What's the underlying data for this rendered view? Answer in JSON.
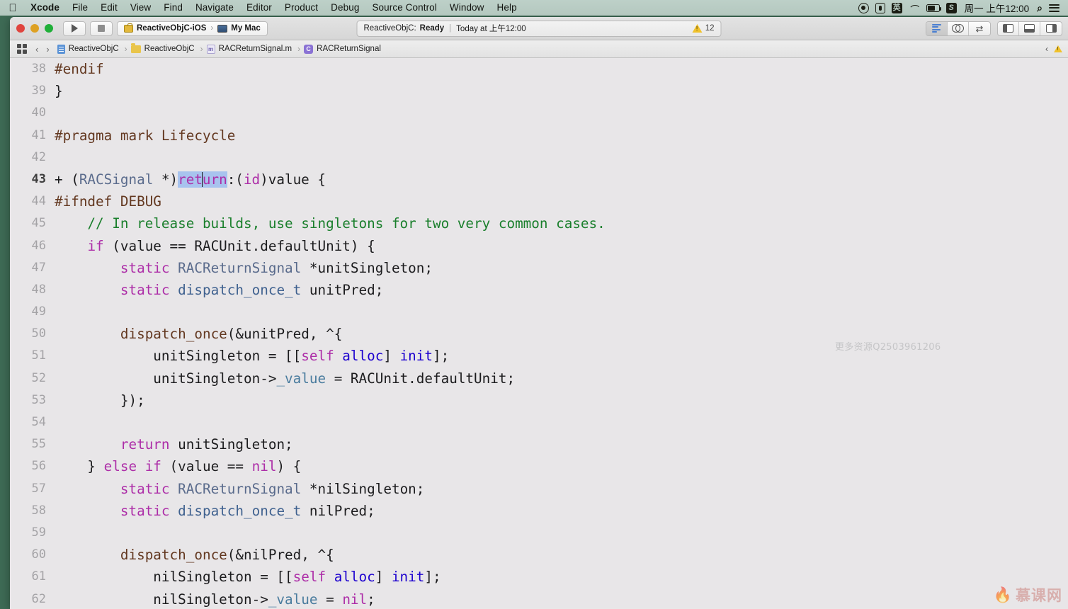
{
  "menubar": {
    "apple_icon": "apple-logo",
    "items": [
      "Xcode",
      "File",
      "Edit",
      "View",
      "Find",
      "Navigate",
      "Editor",
      "Product",
      "Debug",
      "Source Control",
      "Window",
      "Help"
    ],
    "status_icons": [
      "record-icon",
      "microphone-icon",
      "input-method-icon",
      "wifi-icon",
      "battery-charging-icon",
      "sogou-input-icon"
    ],
    "ime_label": "英",
    "sogou_label": "S",
    "clock": "周一 上午12:00",
    "search_icon": "search-icon",
    "control_center_icon": "control-center-icon",
    "bg_color": "#b4c8bf"
  },
  "toolbar": {
    "close_label": "",
    "run_icon": "play-icon",
    "stop_icon": "stop-icon",
    "scheme": {
      "target_icon": "toolbox-icon",
      "target": "ReactiveObjC-iOS",
      "separator": "›",
      "destination_icon": "mac-icon",
      "destination": "My Mac"
    },
    "status": {
      "project": "ReactiveObjC:",
      "state": "Ready",
      "divider": "|",
      "time": "Today at 上午12:00",
      "warning_icon": "warning-triangle-icon",
      "warning_count": "12"
    },
    "editor_modes": [
      "standard-editor-icon",
      "assistant-editor-icon",
      "version-editor-icon"
    ],
    "view_toggles": [
      "navigator-pane-icon",
      "debug-pane-icon",
      "utilities-pane-icon"
    ]
  },
  "jumpbar": {
    "grid_icon": "related-items-icon",
    "back_icon": "back-chevron-icon",
    "forward_icon": "forward-chevron-icon",
    "crumbs": [
      {
        "icon": "project-icon",
        "label": "ReactiveObjC"
      },
      {
        "icon": "folder-icon",
        "label": "ReactiveObjC"
      },
      {
        "icon": "m-file-icon",
        "label": "RACReturnSignal.m",
        "badge": "m"
      },
      {
        "icon": "class-icon",
        "label": "RACReturnSignal",
        "badge": "C"
      }
    ],
    "separator": "›",
    "right_chevron": "‹",
    "warning_icon": "warning-triangle-icon"
  },
  "editor": {
    "watermark": "更多资源Q2503961206",
    "logo_flame": "▲",
    "logo_text": "慕课网",
    "bg_color": "#e8e6e8",
    "selection_color": "#a8c3ee",
    "lines": [
      {
        "n": "38",
        "tokens": [
          {
            "t": "#endif",
            "c": "t-pre"
          }
        ]
      },
      {
        "n": "39",
        "tokens": [
          {
            "t": "}",
            "c": "t-plain"
          }
        ]
      },
      {
        "n": "40",
        "tokens": []
      },
      {
        "n": "41",
        "tokens": [
          {
            "t": "#pragma mark ",
            "c": "t-pre"
          },
          {
            "t": "Lifecycle",
            "c": "t-pre"
          }
        ]
      },
      {
        "n": "42",
        "tokens": []
      },
      {
        "n": "43",
        "current": true,
        "tokens": [
          {
            "t": "+ (",
            "c": "t-plain"
          },
          {
            "t": "RACSignal",
            "c": "t-type"
          },
          {
            "t": " *)",
            "c": "t-plain"
          },
          {
            "t": "ret",
            "c": "t-kw",
            "sel": true
          },
          {
            "t": "CARET"
          },
          {
            "t": "urn",
            "c": "t-kw",
            "sel": true
          },
          {
            "t": ":(",
            "c": "t-plain"
          },
          {
            "t": "id",
            "c": "t-kw"
          },
          {
            "t": ")value {",
            "c": "t-plain"
          }
        ]
      },
      {
        "n": "44",
        "tokens": [
          {
            "t": "#ifndef DEBUG",
            "c": "t-pre"
          }
        ]
      },
      {
        "n": "45",
        "tokens": [
          {
            "t": "    // In release builds, use singletons for two very common cases.",
            "c": "t-comment"
          }
        ]
      },
      {
        "n": "46",
        "tokens": [
          {
            "t": "    ",
            "c": "t-plain"
          },
          {
            "t": "if",
            "c": "t-kw"
          },
          {
            "t": " (value == RACUnit.defaultUnit) {",
            "c": "t-plain"
          }
        ]
      },
      {
        "n": "47",
        "tokens": [
          {
            "t": "        ",
            "c": "t-plain"
          },
          {
            "t": "static",
            "c": "t-kw"
          },
          {
            "t": " ",
            "c": "t-plain"
          },
          {
            "t": "RACReturnSignal",
            "c": "t-type"
          },
          {
            "t": " *unitSingleton;",
            "c": "t-plain"
          }
        ]
      },
      {
        "n": "48",
        "tokens": [
          {
            "t": "        ",
            "c": "t-plain"
          },
          {
            "t": "static",
            "c": "t-kw"
          },
          {
            "t": " ",
            "c": "t-plain"
          },
          {
            "t": "dispatch_once_t",
            "c": "t-typeb"
          },
          {
            "t": " unitPred;",
            "c": "t-plain"
          }
        ]
      },
      {
        "n": "49",
        "tokens": []
      },
      {
        "n": "50",
        "tokens": [
          {
            "t": "        ",
            "c": "t-plain"
          },
          {
            "t": "dispatch_once",
            "c": "t-func"
          },
          {
            "t": "(&unitPred, ^{",
            "c": "t-plain"
          }
        ]
      },
      {
        "n": "51",
        "tokens": [
          {
            "t": "            unitSingleton = [[",
            "c": "t-plain"
          },
          {
            "t": "self",
            "c": "t-kw"
          },
          {
            "t": " ",
            "c": "t-plain"
          },
          {
            "t": "alloc",
            "c": "t-num"
          },
          {
            "t": "] ",
            "c": "t-plain"
          },
          {
            "t": "init",
            "c": "t-num"
          },
          {
            "t": "];",
            "c": "t-plain"
          }
        ]
      },
      {
        "n": "52",
        "tokens": [
          {
            "t": "            unitSingleton->",
            "c": "t-plain"
          },
          {
            "t": "_value",
            "c": "t-ivar"
          },
          {
            "t": " = RACUnit.defaultUnit;",
            "c": "t-plain"
          }
        ]
      },
      {
        "n": "53",
        "tokens": [
          {
            "t": "        });",
            "c": "t-plain"
          }
        ]
      },
      {
        "n": "54",
        "tokens": []
      },
      {
        "n": "55",
        "tokens": [
          {
            "t": "        ",
            "c": "t-plain"
          },
          {
            "t": "return",
            "c": "t-kw"
          },
          {
            "t": " unitSingleton;",
            "c": "t-plain"
          }
        ]
      },
      {
        "n": "56",
        "tokens": [
          {
            "t": "    } ",
            "c": "t-plain"
          },
          {
            "t": "else",
            "c": "t-kw"
          },
          {
            "t": " ",
            "c": "t-plain"
          },
          {
            "t": "if",
            "c": "t-kw"
          },
          {
            "t": " (value == ",
            "c": "t-plain"
          },
          {
            "t": "nil",
            "c": "t-kw"
          },
          {
            "t": ") {",
            "c": "t-plain"
          }
        ]
      },
      {
        "n": "57",
        "tokens": [
          {
            "t": "        ",
            "c": "t-plain"
          },
          {
            "t": "static",
            "c": "t-kw"
          },
          {
            "t": " ",
            "c": "t-plain"
          },
          {
            "t": "RACReturnSignal",
            "c": "t-type"
          },
          {
            "t": " *nilSingleton;",
            "c": "t-plain"
          }
        ]
      },
      {
        "n": "58",
        "tokens": [
          {
            "t": "        ",
            "c": "t-plain"
          },
          {
            "t": "static",
            "c": "t-kw"
          },
          {
            "t": " ",
            "c": "t-plain"
          },
          {
            "t": "dispatch_once_t",
            "c": "t-typeb"
          },
          {
            "t": " nilPred;",
            "c": "t-plain"
          }
        ]
      },
      {
        "n": "59",
        "tokens": []
      },
      {
        "n": "60",
        "tokens": [
          {
            "t": "        ",
            "c": "t-plain"
          },
          {
            "t": "dispatch_once",
            "c": "t-func"
          },
          {
            "t": "(&nilPred, ^{",
            "c": "t-plain"
          }
        ]
      },
      {
        "n": "61",
        "tokens": [
          {
            "t": "            nilSingleton = [[",
            "c": "t-plain"
          },
          {
            "t": "self",
            "c": "t-kw"
          },
          {
            "t": " ",
            "c": "t-plain"
          },
          {
            "t": "alloc",
            "c": "t-num"
          },
          {
            "t": "] ",
            "c": "t-plain"
          },
          {
            "t": "init",
            "c": "t-num"
          },
          {
            "t": "];",
            "c": "t-plain"
          }
        ]
      },
      {
        "n": "62",
        "tokens": [
          {
            "t": "            nilSingleton->",
            "c": "t-plain"
          },
          {
            "t": "_value",
            "c": "t-ivar"
          },
          {
            "t": " = ",
            "c": "t-plain"
          },
          {
            "t": "nil",
            "c": "t-kw"
          },
          {
            "t": ";",
            "c": "t-plain"
          }
        ]
      }
    ]
  }
}
